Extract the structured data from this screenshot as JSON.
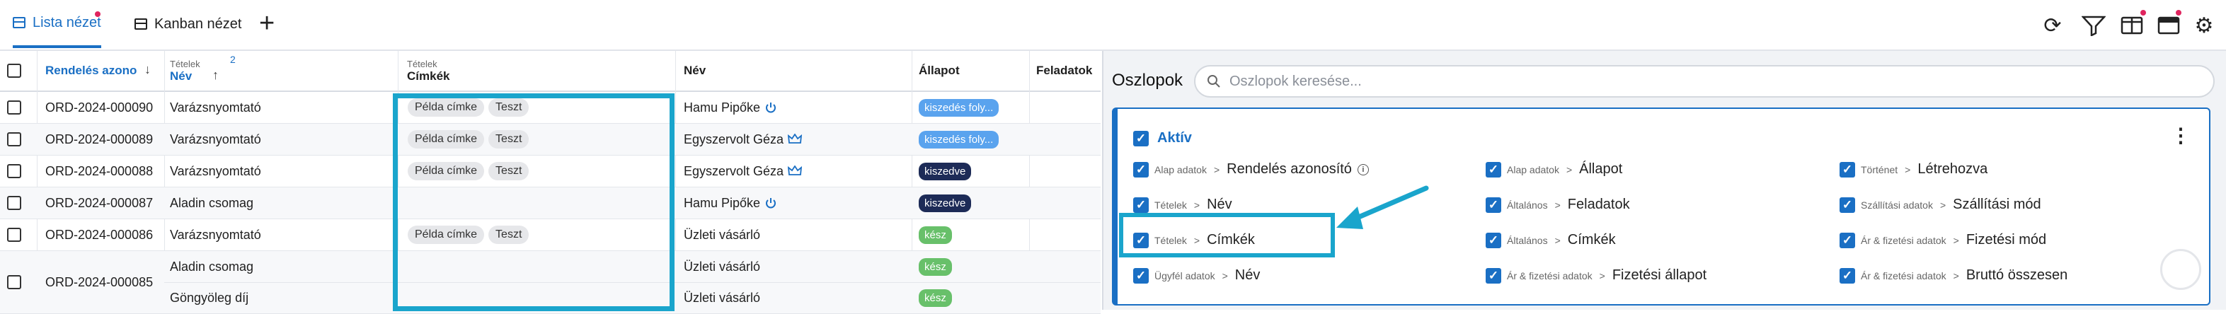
{
  "view_tabs": [
    {
      "label": "Lista nézet"
    },
    {
      "label": "Kanban nézet"
    }
  ],
  "toolbar": {
    "add": "+",
    "refresh": "⟳",
    "filter": "⛛",
    "columns": "◫",
    "notifications": "▬",
    "settings": "⚙"
  },
  "table": {
    "headers": {
      "order_id": "Rendelés azonosító",
      "items_group": "Tételek",
      "items_name": "Név",
      "sort_badge": "2",
      "tags_group": "Tételek",
      "tags": "Címkék",
      "customer": "Név",
      "status": "Állapot",
      "tasks": "Feladatok"
    },
    "rows": [
      {
        "id": "ORD-2024-000090",
        "item": "Varázsnyomtató",
        "tags": [
          "Példa címke",
          "Teszt"
        ],
        "customer": "Hamu Pipőke",
        "customer_icon": "power-icon",
        "status": "kiszedés foly...",
        "status_type": "inprog"
      },
      {
        "id": "ORD-2024-000089",
        "item": "Varázsnyomtató",
        "tags": [
          "Példa címke",
          "Teszt"
        ],
        "customer": "Egyszervolt Géza",
        "customer_icon": "crown-icon",
        "status": "kiszedés foly...",
        "status_type": "inprog"
      },
      {
        "id": "ORD-2024-000088",
        "item": "Varázsnyomtató",
        "tags": [
          "Példa címke",
          "Teszt"
        ],
        "customer": "Egyszervolt Géza",
        "customer_icon": "crown-icon",
        "status": "kiszedve",
        "status_type": "sent"
      },
      {
        "id": "ORD-2024-000087",
        "item": "Aladin csomag",
        "tags": [],
        "customer": "Hamu Pipőke",
        "customer_icon": "power-icon",
        "status": "kiszedve",
        "status_type": "sent"
      },
      {
        "id": "ORD-2024-000086",
        "item": "Varázsnyomtató",
        "tags": [
          "Példa címke",
          "Teszt"
        ],
        "customer": "Üzleti vásárló",
        "customer_icon": "",
        "status": "kész",
        "status_type": "done"
      }
    ],
    "merged_row": {
      "id": "ORD-2024-000085",
      "sub": [
        {
          "item": "Aladin csomag",
          "customer": "Üzleti vásárló",
          "status": "kész"
        },
        {
          "item": "Göngyöleg díj",
          "customer": "Üzleti vásárló",
          "status": "kész"
        }
      ]
    }
  },
  "panel": {
    "title": "Oszlopok",
    "search_placeholder": "Oszlopok keresése...",
    "section": "Aktív",
    "separator": ">",
    "columns": [
      [
        {
          "group": "Alap adatok",
          "name": "Rendelés azonosító",
          "info": true
        },
        {
          "group": "Tételek",
          "name": "Név"
        },
        {
          "group": "Tételek",
          "name": "Címkék"
        },
        {
          "group": "Ügyfél adatok",
          "name": "Név"
        }
      ],
      [
        {
          "group": "Alap adatok",
          "name": "Állapot"
        },
        {
          "group": "Általános",
          "name": "Feladatok"
        },
        {
          "group": "Általános",
          "name": "Címkék"
        },
        {
          "group": "Ár & fizetési adatok",
          "name": "Fizetési állapot"
        }
      ],
      [
        {
          "group": "Történet",
          "name": "Létrehozva"
        },
        {
          "group": "Szállítási adatok",
          "name": "Szállítási mód"
        },
        {
          "group": "Ár & fizetési adatok",
          "name": "Fizetési mód"
        },
        {
          "group": "Ár & fizetési adatok",
          "name": "Bruttó összesen"
        }
      ]
    ]
  },
  "colors": {
    "accent": "#1a6fc4",
    "highlight": "#1aa5cc",
    "in_progress": "#5aa3ee",
    "picked": "#1d2b57",
    "done": "#68c06a"
  }
}
